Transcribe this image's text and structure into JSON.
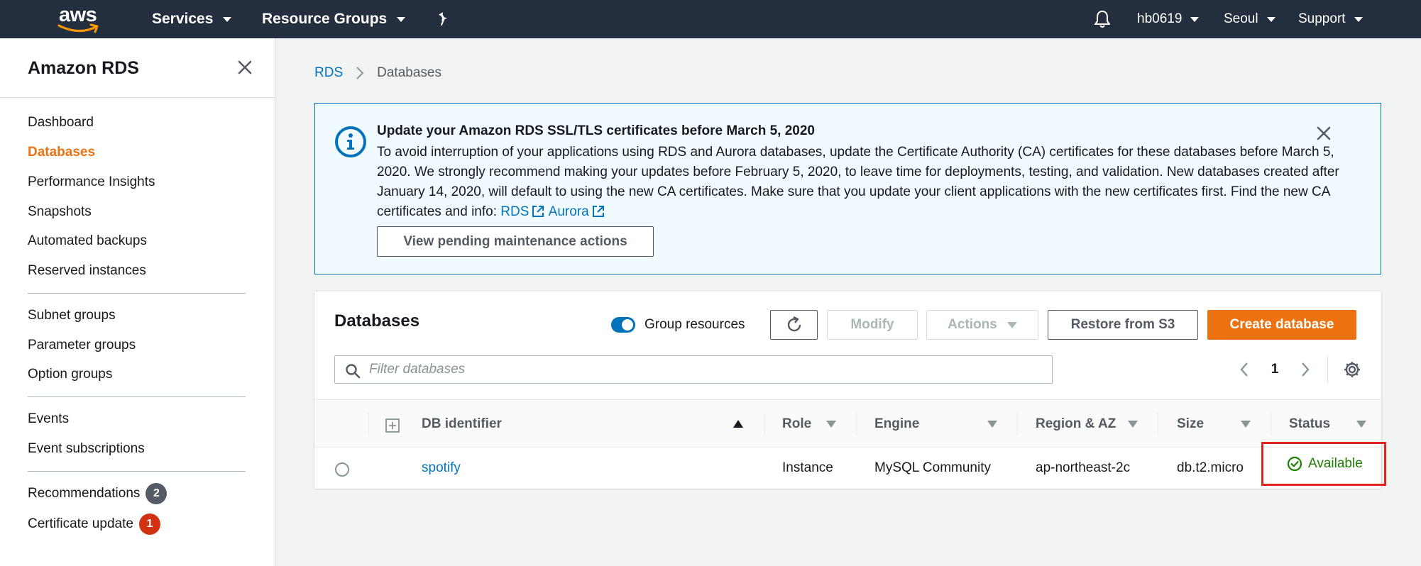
{
  "topnav": {
    "logo_text": "aws",
    "services": "Services",
    "resource_groups": "Resource Groups",
    "user": "hb0619",
    "region": "Seoul",
    "support": "Support"
  },
  "sidebar": {
    "title": "Amazon RDS",
    "items": [
      {
        "label": "Dashboard"
      },
      {
        "label": "Databases",
        "active": true
      },
      {
        "label": "Performance Insights"
      },
      {
        "label": "Snapshots"
      },
      {
        "label": "Automated backups"
      },
      {
        "label": "Reserved instances"
      },
      {
        "label": "Subnet groups"
      },
      {
        "label": "Parameter groups"
      },
      {
        "label": "Option groups"
      },
      {
        "label": "Events"
      },
      {
        "label": "Event subscriptions"
      },
      {
        "label": "Recommendations",
        "badge": "2"
      },
      {
        "label": "Certificate update",
        "badge": "1"
      }
    ]
  },
  "breadcrumb": {
    "root": "RDS",
    "current": "Databases"
  },
  "alert": {
    "title": "Update your Amazon RDS SSL/TLS certificates before March 5, 2020",
    "body": "To avoid interruption of your applications using RDS and Aurora databases, update the Certificate Authority (CA) certificates for these databases before March 5, 2020. We strongly recommend making your updates before February 5, 2020, to leave time for deployments, testing, and validation. New databases created after January 14, 2020, will default to using the new CA certificates. Make sure that you update your client applications with the new certificates first. Find the new CA certificates and info:",
    "link_rds": "RDS",
    "link_aurora": "Aurora",
    "button": "View pending maintenance actions"
  },
  "databases": {
    "title": "Databases",
    "group_resources_label": "Group resources",
    "group_resources_on": true,
    "modify_label": "Modify",
    "actions_label": "Actions",
    "restore_label": "Restore from S3",
    "create_label": "Create database",
    "filter_placeholder": "Filter databases",
    "page": "1",
    "columns": {
      "identifier": "DB identifier",
      "role": "Role",
      "engine": "Engine",
      "region": "Region & AZ",
      "size": "Size",
      "status": "Status"
    },
    "rows": [
      {
        "identifier": "spotify",
        "role": "Instance",
        "engine": "MySQL Community",
        "region": "ap-northeast-2c",
        "size": "db.t2.micro",
        "status": "Available"
      }
    ]
  },
  "colors": {
    "nav_bg": "#232f3e",
    "link": "#0073bb",
    "accent": "#ec7211",
    "status_ok": "#1d8102",
    "highlight": "#e3231e"
  }
}
